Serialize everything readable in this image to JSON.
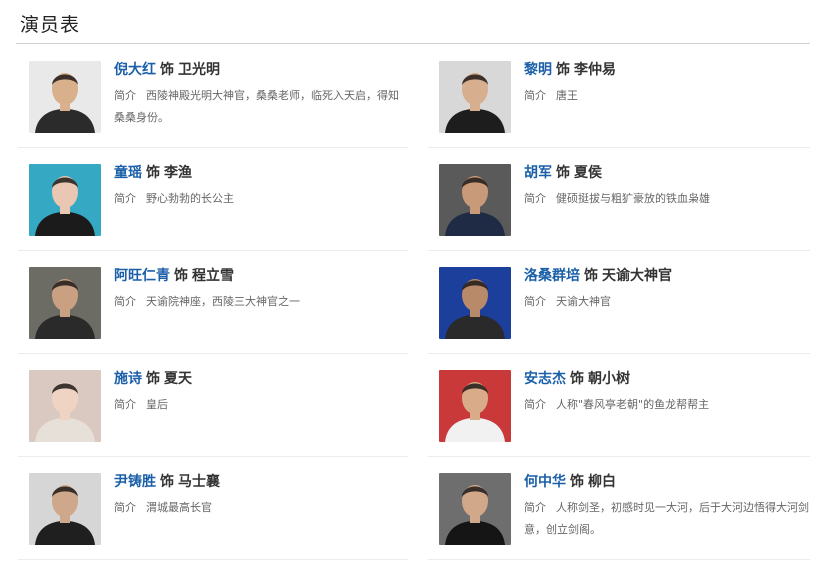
{
  "page_title": "演员表",
  "intro_label": "简介",
  "shi": "饰",
  "colors": {
    "actor_name": "#1a5fa8",
    "text": "#333333",
    "muted": "#666666"
  },
  "cast": [
    {
      "actor": "倪大红",
      "role": "卫光明",
      "intro": "西陵神殿光明大神官，桑桑老师，临死入天启，得知桑桑身份。",
      "photo_bg": "#e9e9e9",
      "skin": "#d9b08c",
      "cloth": "#2b2b2b"
    },
    {
      "actor": "黎明",
      "role": "李仲易",
      "intro": "唐王",
      "photo_bg": "#d8d8d8",
      "skin": "#d7ae8e",
      "cloth": "#1d1d1d"
    },
    {
      "actor": "童瑶",
      "role": "李渔",
      "intro": "野心勃勃的长公主",
      "photo_bg": "#35a9c4",
      "skin": "#e9c7b2",
      "cloth": "#1b1b1b"
    },
    {
      "actor": "胡军",
      "role": "夏侯",
      "intro": "健硕挺拔与粗犷豪放的铁血枭雄",
      "photo_bg": "#5a5a5a",
      "skin": "#c99a7a",
      "cloth": "#1f2a44"
    },
    {
      "actor": "阿旺仁青",
      "role": "程立雪",
      "intro": "天谕院神座，西陵三大神官之一",
      "photo_bg": "#6c6c64",
      "skin": "#caa083",
      "cloth": "#2a2a2a"
    },
    {
      "actor": "洛桑群培",
      "role": "天谕大神官",
      "intro": "天谕大神官",
      "photo_bg": "#1c3f9c",
      "skin": "#b98a6a",
      "cloth": "#2a2a2a"
    },
    {
      "actor": "施诗",
      "role": "夏天",
      "intro": "皇后",
      "photo_bg": "#d9c9c0",
      "skin": "#efd3c3",
      "cloth": "#e6e0d8"
    },
    {
      "actor": "安志杰",
      "role": "朝小树",
      "intro": "人称\"春风亭老朝\"的鱼龙帮帮主",
      "photo_bg": "#c9393a",
      "skin": "#d9ab88",
      "cloth": "#f1f1f1"
    },
    {
      "actor": "尹铸胜",
      "role": "马士襄",
      "intro": "渭城最高长官",
      "photo_bg": "#d6d6d6",
      "skin": "#cfa78a",
      "cloth": "#1f1f1f"
    },
    {
      "actor": "何中华",
      "role": "柳白",
      "intro": "人称剑圣，初感时见一大河，后于大河边悟得大河剑意，创立剑阁。",
      "photo_bg": "#6e6e6e",
      "skin": "#d1a889",
      "cloth": "#151515"
    }
  ]
}
